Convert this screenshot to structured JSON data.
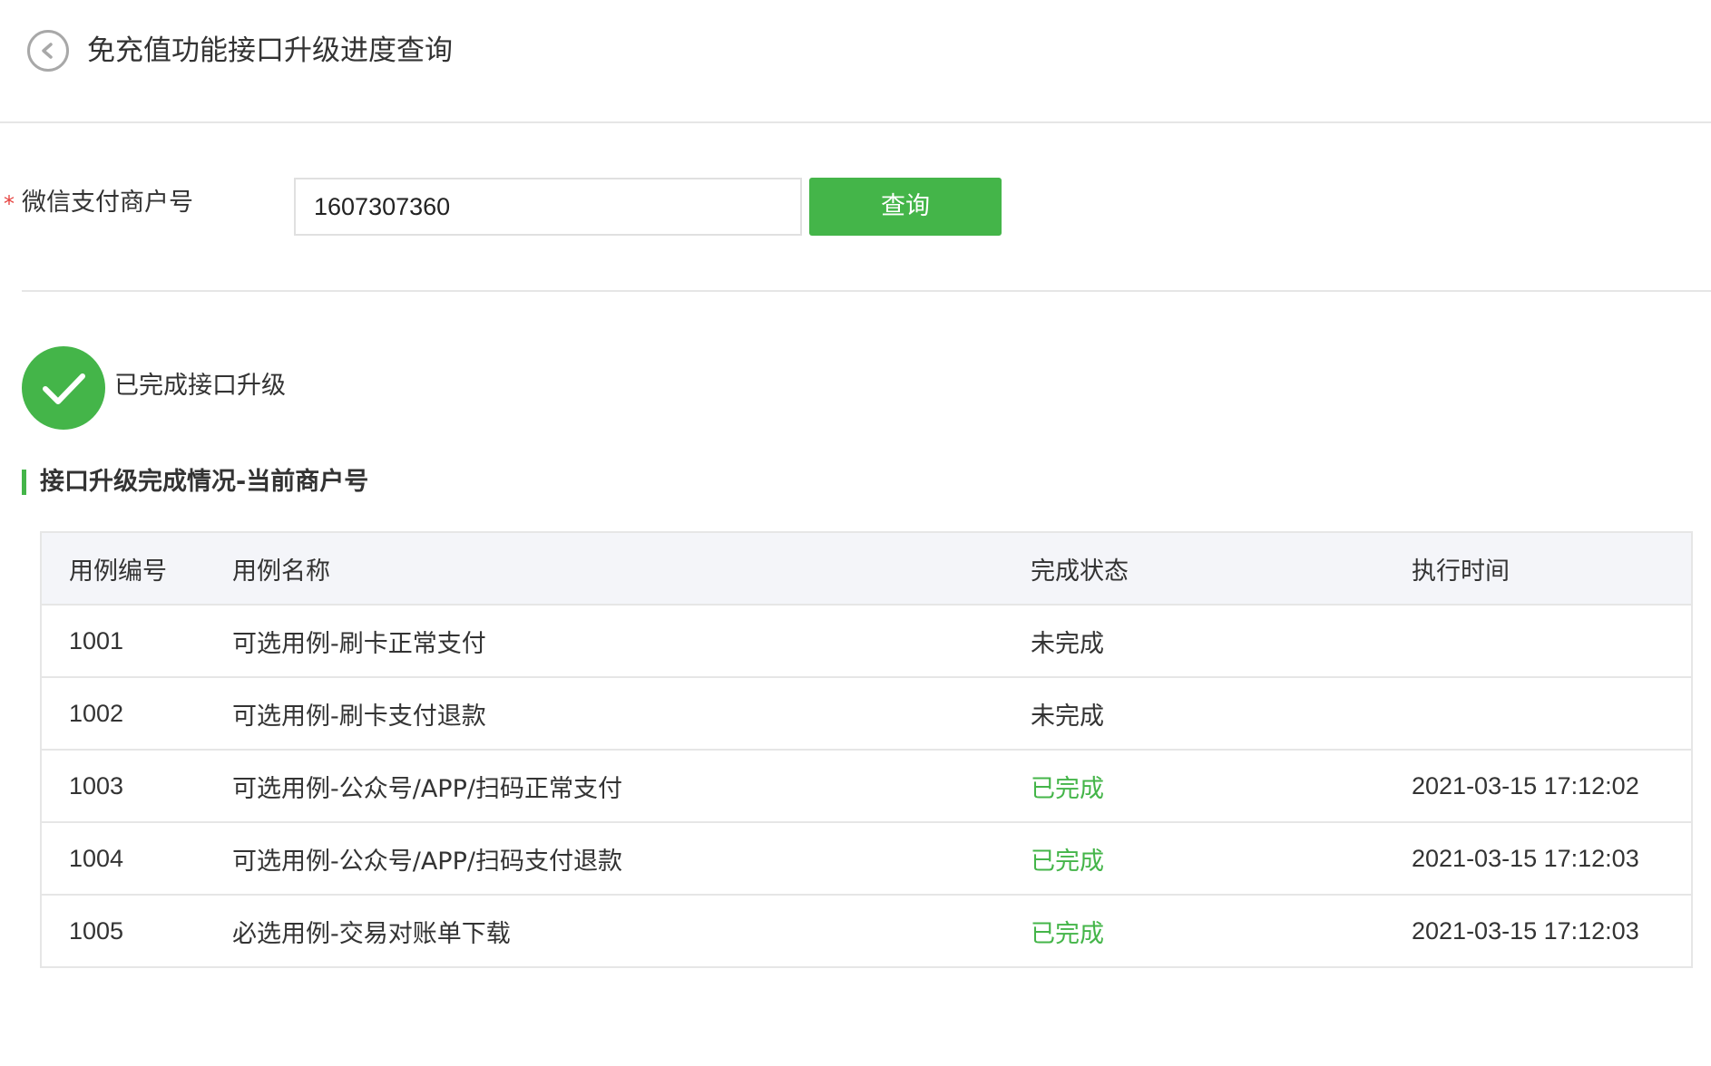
{
  "header": {
    "title": "免充值功能接口升级进度查询"
  },
  "form": {
    "required_mark": "*",
    "label": "微信支付商户号",
    "merchant_id": "1607307360",
    "query_button": "查询"
  },
  "status": {
    "text": "已完成接口升级",
    "color": "#44b549"
  },
  "section": {
    "title": "接口升级完成情况-当前商户号"
  },
  "table": {
    "headers": [
      "用例编号",
      "用例名称",
      "完成状态",
      "执行时间"
    ],
    "rows": [
      {
        "id": "1001",
        "name": "可选用例-刷卡正常支付",
        "status": "未完成",
        "done": false,
        "time": ""
      },
      {
        "id": "1002",
        "name": "可选用例-刷卡支付退款",
        "status": "未完成",
        "done": false,
        "time": ""
      },
      {
        "id": "1003",
        "name": "可选用例-公众号/APP/扫码正常支付",
        "status": "已完成",
        "done": true,
        "time": "2021-03-15 17:12:02"
      },
      {
        "id": "1004",
        "name": "可选用例-公众号/APP/扫码支付退款",
        "status": "已完成",
        "done": true,
        "time": "2021-03-15 17:12:03"
      },
      {
        "id": "1005",
        "name": "必选用例-交易对账单下载",
        "status": "已完成",
        "done": true,
        "time": "2021-03-15 17:12:03"
      }
    ]
  },
  "colors": {
    "accent_green": "#44b549",
    "required_red": "#e64340",
    "table_header_bg": "#f4f5f9",
    "border": "#e6e6e6"
  }
}
